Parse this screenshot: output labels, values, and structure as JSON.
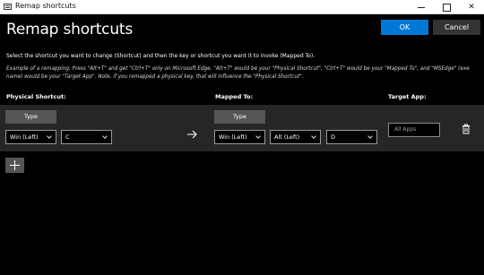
{
  "window": {
    "title": "Remap shortcuts",
    "close_glyph": "✕"
  },
  "header": {
    "title": "Remap shortcuts",
    "ok_label": "OK",
    "cancel_label": "Cancel"
  },
  "instructions": {
    "main": "Select the shortcut you want to change (Shortcut) and then the key or shortcut you want it to invoke (Mapped To).",
    "example": "Example of a remapping: Press \"Alt+T\" and get \"Ctrl+T\" only on Microsoft Edge, \"Alt+T\" would be your \"Physical Shortcut\", \"Ctrl+T\" would be your \"Mapped To\", and \"MSEdge\" (exe name) would be your \"Target App\". Note, if you remapped a physical key, that will influence the \"Physical Shortcut\"."
  },
  "columns": {
    "physical": "Physical Shortcut:",
    "mapped": "Mapped To:",
    "target": "Target App:"
  },
  "row": {
    "physical_type_label": "Type",
    "physical_keys": [
      "Win (Left)",
      "C"
    ],
    "mapped_type_label": "Type",
    "mapped_keys": [
      "Win (Left)",
      "Alt (Left)",
      "D"
    ],
    "target_placeholder": "All Apps"
  },
  "icons": {
    "arrow": "arrow-right-icon",
    "delete": "trash-icon",
    "add": "plus-icon",
    "app": "keyboard-app-icon"
  },
  "colors": {
    "accent": "#0078d7",
    "row_background": "#262626",
    "button_background": "#555555"
  }
}
